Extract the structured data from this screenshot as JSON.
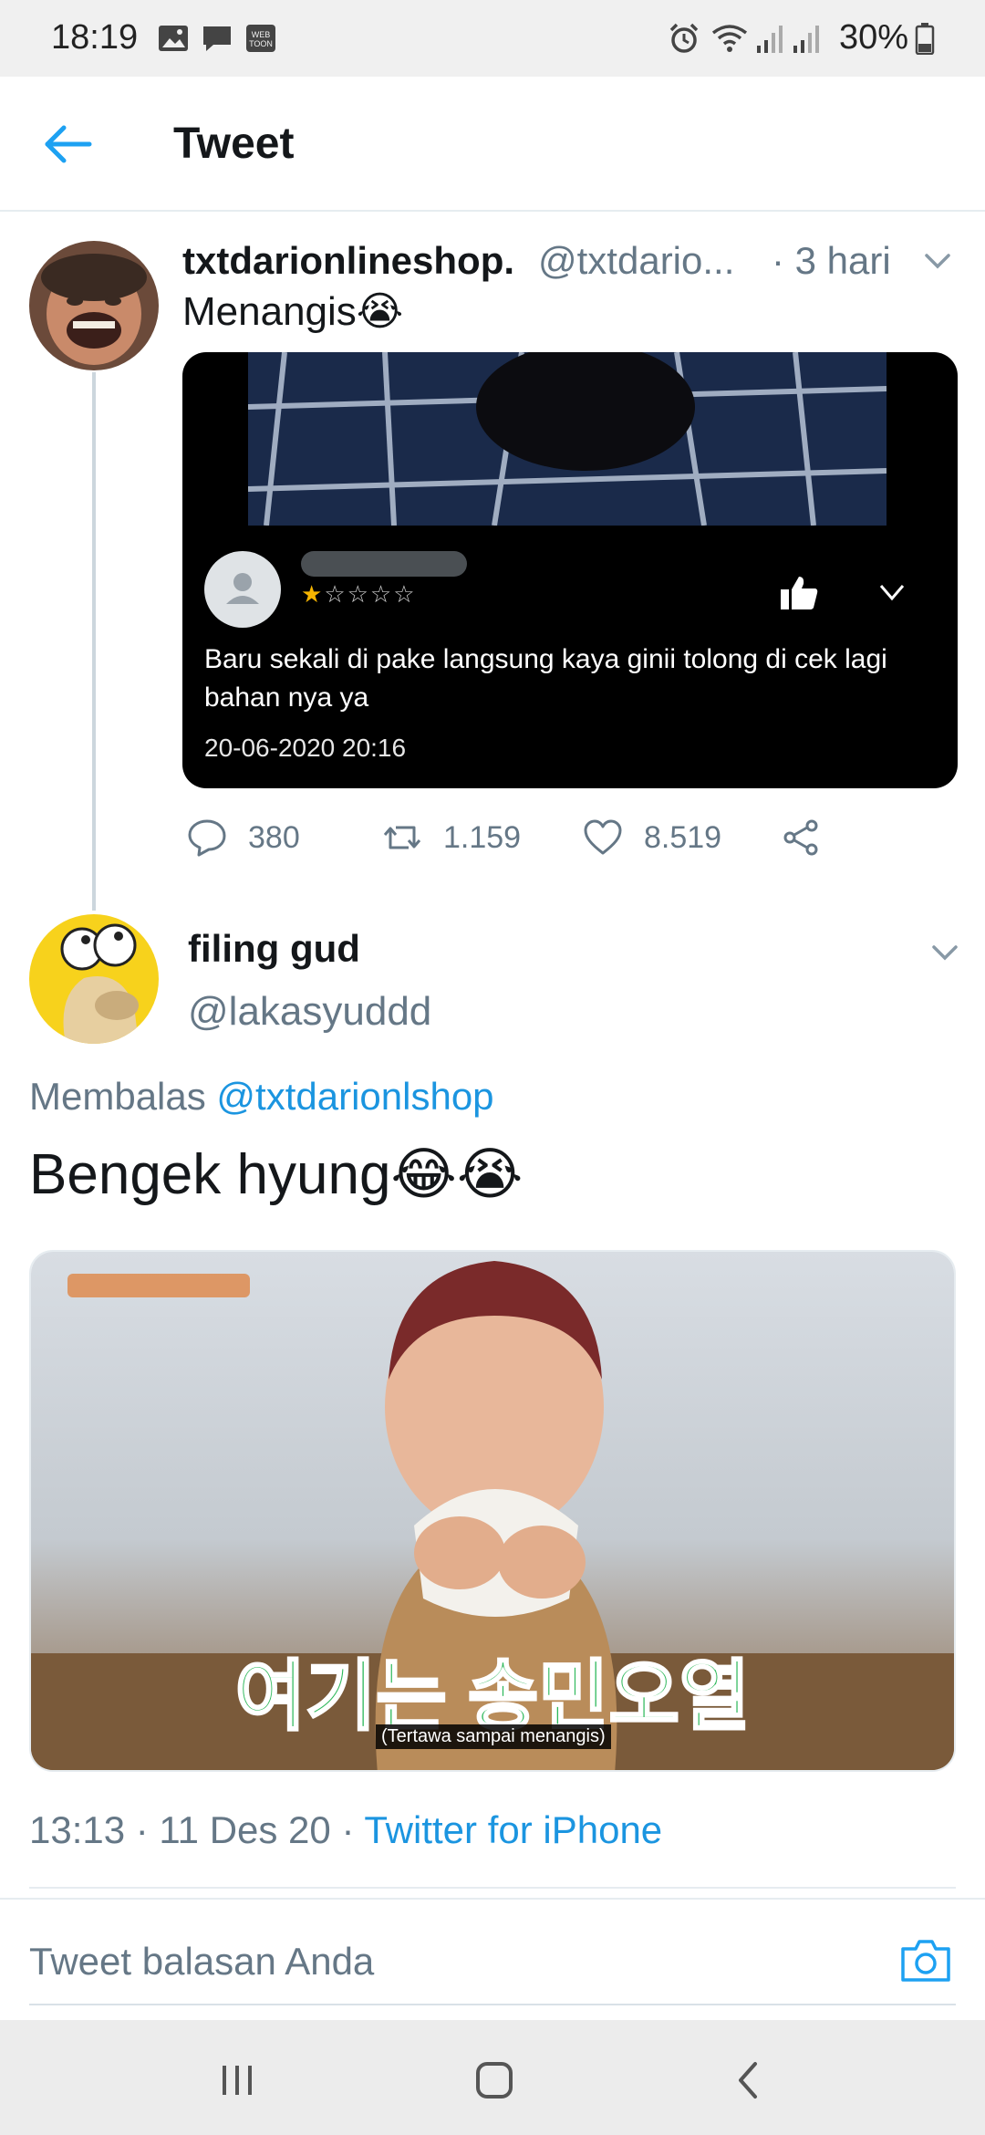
{
  "status_bar": {
    "time": "18:19",
    "notification_icons": [
      "gallery-icon",
      "message-icon",
      "webtoon-icon"
    ],
    "system_icons": [
      "alarm-icon",
      "wifi-icon",
      "signal-icon",
      "signal-icon",
      "battery-icon"
    ],
    "battery": "30%"
  },
  "header": {
    "back_icon": "arrow-left-icon",
    "title": "Tweet"
  },
  "parent_tweet": {
    "name": "txtdarionlineshop.",
    "handle": "@txtdario...",
    "time": "· 3 hari",
    "text": "Menangis😭",
    "media": {
      "stars": "★☆☆☆☆",
      "rating": 1,
      "review_text": "Baru sekali di pake langsung kaya ginii tolong di cek lagi bahan nya ya",
      "date": "20-06-2020 20:16"
    },
    "actions": {
      "replies": "380",
      "retweets": "1.159",
      "likes": "8.519"
    }
  },
  "main_tweet": {
    "name": "filing gud",
    "handle": "@lakasyuddd",
    "reply_prefix": "Membalas ",
    "reply_mention": "@txtdarionlshop",
    "text": "Bengek hyung😂😭",
    "media": {
      "caption_korean": "여기는 송민오열",
      "caption_sub": "(Tertawa sampai menangis)"
    },
    "meta_time": "13:13 · 11 Des 20 · ",
    "meta_source": "Twitter for iPhone"
  },
  "reply_bar": {
    "placeholder": "Tweet balasan Anda",
    "camera_icon": "camera-icon"
  },
  "nav_bar": {
    "buttons": [
      "recent-apps-icon",
      "home-icon",
      "back-icon"
    ]
  },
  "colors": {
    "accent": "#1b95e0",
    "secondary_text": "#657786",
    "divider": "#e6ecf0"
  }
}
